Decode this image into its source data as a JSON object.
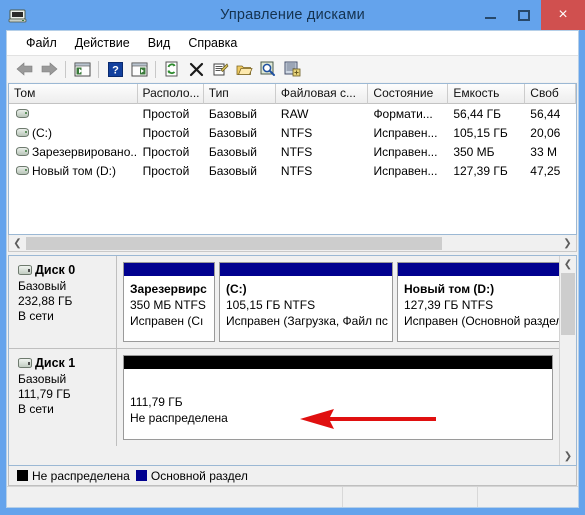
{
  "window": {
    "title": "Управление дисками",
    "icon": "disk-management-icon",
    "title_bar_color": "#64a3ec",
    "close_button_color": "#d0504f",
    "minimize_label": "",
    "maximize_label": "",
    "close_label": "×"
  },
  "menubar": {
    "items": [
      {
        "label": "Файл"
      },
      {
        "label": "Действие"
      },
      {
        "label": "Вид"
      },
      {
        "label": "Справка"
      }
    ]
  },
  "toolbar": {
    "buttons": [
      {
        "name": "back-arrow-icon"
      },
      {
        "name": "forward-arrow-icon"
      },
      {
        "name": "show-console-tree-icon"
      },
      {
        "name": "help-icon"
      },
      {
        "name": "show-action-pane-icon"
      },
      {
        "name": "refresh-icon"
      },
      {
        "name": "delete-icon"
      },
      {
        "name": "properties-icon"
      },
      {
        "name": "open-folder-icon"
      },
      {
        "name": "search-icon"
      },
      {
        "name": "rescan-disks-icon"
      }
    ]
  },
  "volume_list": {
    "columns": [
      {
        "label": "Том"
      },
      {
        "label": "Располо..."
      },
      {
        "label": "Тип"
      },
      {
        "label": "Файловая с..."
      },
      {
        "label": "Состояние"
      },
      {
        "label": "Емкость"
      },
      {
        "label": "Своб"
      }
    ],
    "rows": [
      {
        "name": "",
        "layout": "Простой",
        "type": "Базовый",
        "filesystem": "RAW",
        "status": "Формати...",
        "capacity": "56,44 ГБ",
        "free": "56,44"
      },
      {
        "name": "(C:)",
        "layout": "Простой",
        "type": "Базовый",
        "filesystem": "NTFS",
        "status": "Исправен...",
        "capacity": "105,15 ГБ",
        "free": "20,06"
      },
      {
        "name": "Зарезервировано...",
        "layout": "Простой",
        "type": "Базовый",
        "filesystem": "NTFS",
        "status": "Исправен...",
        "capacity": "350 МБ",
        "free": "33 М"
      },
      {
        "name": "Новый том (D:)",
        "layout": "Простой",
        "type": "Базовый",
        "filesystem": "NTFS",
        "status": "Исправен...",
        "capacity": "127,39 ГБ",
        "free": "47,25"
      }
    ]
  },
  "graphic_view": {
    "disks": [
      {
        "title": "Диск 0",
        "type": "Базовый",
        "size": "232,88 ГБ",
        "state": "В сети",
        "partitions": [
          {
            "label": "Зарезервирс",
            "size": "350 МБ NTFS",
            "status": "Исправен (Сı",
            "cap_color": "#00008f"
          },
          {
            "label": "(C:)",
            "size": "105,15 ГБ NTFS",
            "status": "Исправен (Загрузка, Файл пс",
            "cap_color": "#00008f"
          },
          {
            "label": "Новый том  (D:)",
            "size": "127,39 ГБ NTFS",
            "status": "Исправен (Основной раздел)",
            "cap_color": "#00008f"
          }
        ]
      },
      {
        "title": "Диск 1",
        "type": "Базовый",
        "size": "111,79 ГБ",
        "state": "В сети",
        "partitions": [
          {
            "label": "",
            "size": "111,79 ГБ",
            "status": "Не распределена",
            "cap_color": "#000000"
          }
        ]
      }
    ]
  },
  "legend": {
    "items": [
      {
        "label": "Не распределена",
        "color": "#000000"
      },
      {
        "label": "Основной раздел",
        "color": "#00008f"
      }
    ]
  },
  "annotation": {
    "arrow_color": "#e01010",
    "direction": "left"
  },
  "statusbar": {
    "cells": [
      "",
      "",
      ""
    ]
  }
}
